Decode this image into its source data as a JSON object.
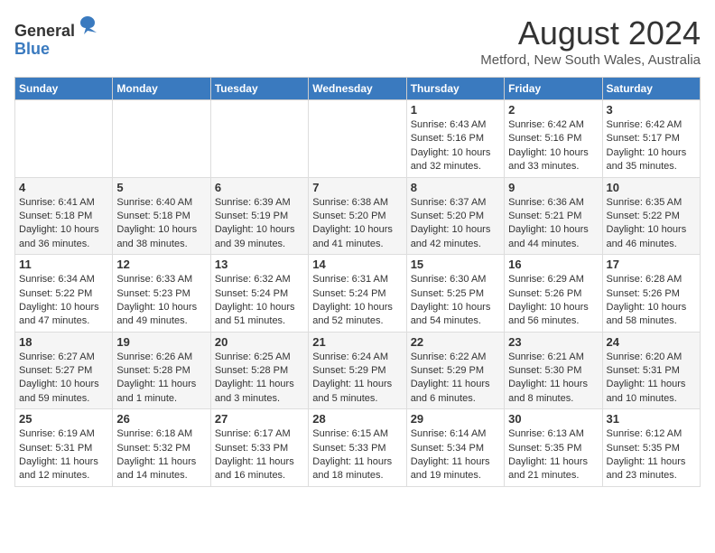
{
  "header": {
    "logo_line1": "General",
    "logo_line2": "Blue",
    "month_year": "August 2024",
    "location": "Metford, New South Wales, Australia"
  },
  "days_of_week": [
    "Sunday",
    "Monday",
    "Tuesday",
    "Wednesday",
    "Thursday",
    "Friday",
    "Saturday"
  ],
  "weeks": [
    [
      {
        "day": "",
        "sunrise": "",
        "sunset": "",
        "daylight": ""
      },
      {
        "day": "",
        "sunrise": "",
        "sunset": "",
        "daylight": ""
      },
      {
        "day": "",
        "sunrise": "",
        "sunset": "",
        "daylight": ""
      },
      {
        "day": "",
        "sunrise": "",
        "sunset": "",
        "daylight": ""
      },
      {
        "day": "1",
        "sunrise": "Sunrise: 6:43 AM",
        "sunset": "Sunset: 5:16 PM",
        "daylight": "Daylight: 10 hours and 32 minutes."
      },
      {
        "day": "2",
        "sunrise": "Sunrise: 6:42 AM",
        "sunset": "Sunset: 5:16 PM",
        "daylight": "Daylight: 10 hours and 33 minutes."
      },
      {
        "day": "3",
        "sunrise": "Sunrise: 6:42 AM",
        "sunset": "Sunset: 5:17 PM",
        "daylight": "Daylight: 10 hours and 35 minutes."
      }
    ],
    [
      {
        "day": "4",
        "sunrise": "Sunrise: 6:41 AM",
        "sunset": "Sunset: 5:18 PM",
        "daylight": "Daylight: 10 hours and 36 minutes."
      },
      {
        "day": "5",
        "sunrise": "Sunrise: 6:40 AM",
        "sunset": "Sunset: 5:18 PM",
        "daylight": "Daylight: 10 hours and 38 minutes."
      },
      {
        "day": "6",
        "sunrise": "Sunrise: 6:39 AM",
        "sunset": "Sunset: 5:19 PM",
        "daylight": "Daylight: 10 hours and 39 minutes."
      },
      {
        "day": "7",
        "sunrise": "Sunrise: 6:38 AM",
        "sunset": "Sunset: 5:20 PM",
        "daylight": "Daylight: 10 hours and 41 minutes."
      },
      {
        "day": "8",
        "sunrise": "Sunrise: 6:37 AM",
        "sunset": "Sunset: 5:20 PM",
        "daylight": "Daylight: 10 hours and 42 minutes."
      },
      {
        "day": "9",
        "sunrise": "Sunrise: 6:36 AM",
        "sunset": "Sunset: 5:21 PM",
        "daylight": "Daylight: 10 hours and 44 minutes."
      },
      {
        "day": "10",
        "sunrise": "Sunrise: 6:35 AM",
        "sunset": "Sunset: 5:22 PM",
        "daylight": "Daylight: 10 hours and 46 minutes."
      }
    ],
    [
      {
        "day": "11",
        "sunrise": "Sunrise: 6:34 AM",
        "sunset": "Sunset: 5:22 PM",
        "daylight": "Daylight: 10 hours and 47 minutes."
      },
      {
        "day": "12",
        "sunrise": "Sunrise: 6:33 AM",
        "sunset": "Sunset: 5:23 PM",
        "daylight": "Daylight: 10 hours and 49 minutes."
      },
      {
        "day": "13",
        "sunrise": "Sunrise: 6:32 AM",
        "sunset": "Sunset: 5:24 PM",
        "daylight": "Daylight: 10 hours and 51 minutes."
      },
      {
        "day": "14",
        "sunrise": "Sunrise: 6:31 AM",
        "sunset": "Sunset: 5:24 PM",
        "daylight": "Daylight: 10 hours and 52 minutes."
      },
      {
        "day": "15",
        "sunrise": "Sunrise: 6:30 AM",
        "sunset": "Sunset: 5:25 PM",
        "daylight": "Daylight: 10 hours and 54 minutes."
      },
      {
        "day": "16",
        "sunrise": "Sunrise: 6:29 AM",
        "sunset": "Sunset: 5:26 PM",
        "daylight": "Daylight: 10 hours and 56 minutes."
      },
      {
        "day": "17",
        "sunrise": "Sunrise: 6:28 AM",
        "sunset": "Sunset: 5:26 PM",
        "daylight": "Daylight: 10 hours and 58 minutes."
      }
    ],
    [
      {
        "day": "18",
        "sunrise": "Sunrise: 6:27 AM",
        "sunset": "Sunset: 5:27 PM",
        "daylight": "Daylight: 10 hours and 59 minutes."
      },
      {
        "day": "19",
        "sunrise": "Sunrise: 6:26 AM",
        "sunset": "Sunset: 5:28 PM",
        "daylight": "Daylight: 11 hours and 1 minute."
      },
      {
        "day": "20",
        "sunrise": "Sunrise: 6:25 AM",
        "sunset": "Sunset: 5:28 PM",
        "daylight": "Daylight: 11 hours and 3 minutes."
      },
      {
        "day": "21",
        "sunrise": "Sunrise: 6:24 AM",
        "sunset": "Sunset: 5:29 PM",
        "daylight": "Daylight: 11 hours and 5 minutes."
      },
      {
        "day": "22",
        "sunrise": "Sunrise: 6:22 AM",
        "sunset": "Sunset: 5:29 PM",
        "daylight": "Daylight: 11 hours and 6 minutes."
      },
      {
        "day": "23",
        "sunrise": "Sunrise: 6:21 AM",
        "sunset": "Sunset: 5:30 PM",
        "daylight": "Daylight: 11 hours and 8 minutes."
      },
      {
        "day": "24",
        "sunrise": "Sunrise: 6:20 AM",
        "sunset": "Sunset: 5:31 PM",
        "daylight": "Daylight: 11 hours and 10 minutes."
      }
    ],
    [
      {
        "day": "25",
        "sunrise": "Sunrise: 6:19 AM",
        "sunset": "Sunset: 5:31 PM",
        "daylight": "Daylight: 11 hours and 12 minutes."
      },
      {
        "day": "26",
        "sunrise": "Sunrise: 6:18 AM",
        "sunset": "Sunset: 5:32 PM",
        "daylight": "Daylight: 11 hours and 14 minutes."
      },
      {
        "day": "27",
        "sunrise": "Sunrise: 6:17 AM",
        "sunset": "Sunset: 5:33 PM",
        "daylight": "Daylight: 11 hours and 16 minutes."
      },
      {
        "day": "28",
        "sunrise": "Sunrise: 6:15 AM",
        "sunset": "Sunset: 5:33 PM",
        "daylight": "Daylight: 11 hours and 18 minutes."
      },
      {
        "day": "29",
        "sunrise": "Sunrise: 6:14 AM",
        "sunset": "Sunset: 5:34 PM",
        "daylight": "Daylight: 11 hours and 19 minutes."
      },
      {
        "day": "30",
        "sunrise": "Sunrise: 6:13 AM",
        "sunset": "Sunset: 5:35 PM",
        "daylight": "Daylight: 11 hours and 21 minutes."
      },
      {
        "day": "31",
        "sunrise": "Sunrise: 6:12 AM",
        "sunset": "Sunset: 5:35 PM",
        "daylight": "Daylight: 11 hours and 23 minutes."
      }
    ]
  ]
}
